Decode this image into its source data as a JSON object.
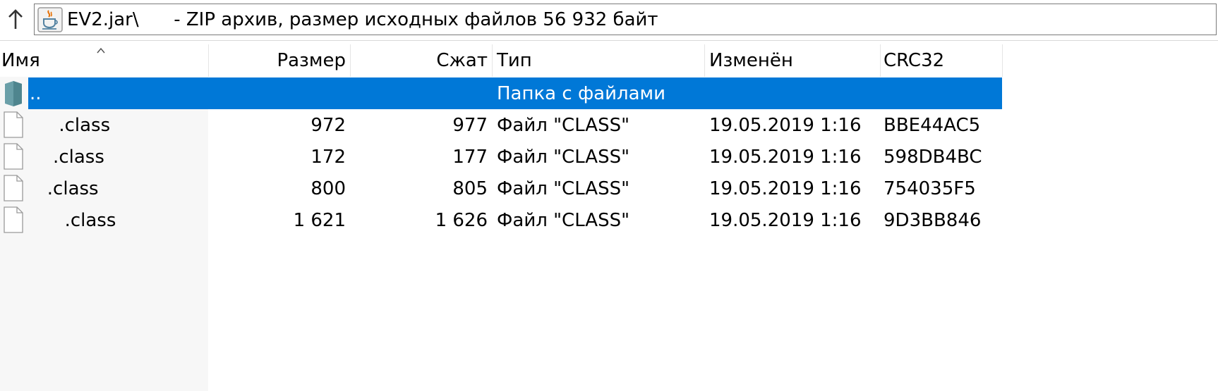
{
  "address": {
    "path": "EV2.jar\\      - ZIP архив, размер исходных файлов 56 932 байт",
    "icon": "java-jar-icon"
  },
  "columns": [
    {
      "key": "name",
      "label": "Имя",
      "sorted": "ascending"
    },
    {
      "key": "size",
      "label": "Размер"
    },
    {
      "key": "packed",
      "label": "Сжат"
    },
    {
      "key": "type",
      "label": "Тип"
    },
    {
      "key": "modified",
      "label": "Изменён"
    },
    {
      "key": "crc",
      "label": "CRC32"
    }
  ],
  "rows": [
    {
      "name": "..",
      "size": "",
      "packed": "",
      "type": "Папка с файлами",
      "modified": "",
      "crc": "",
      "icon": "folder-icon",
      "selected": true
    },
    {
      "name": "     .class",
      "size": "972",
      "packed": "977",
      "type": "Файл \"CLASS\"",
      "modified": "19.05.2019 1:16",
      "crc": "BBE44AC5",
      "icon": "file-icon",
      "selected": false
    },
    {
      "name": "    .class",
      "size": "172",
      "packed": "177",
      "type": "Файл \"CLASS\"",
      "modified": "19.05.2019 1:16",
      "crc": "598DB4BC",
      "icon": "file-icon",
      "selected": false
    },
    {
      "name": "   .class",
      "size": "800",
      "packed": "805",
      "type": "Файл \"CLASS\"",
      "modified": "19.05.2019 1:16",
      "crc": "754035F5",
      "icon": "file-icon",
      "selected": false
    },
    {
      "name": "      .class",
      "size": "1 621",
      "packed": "1 626",
      "type": "Файл \"CLASS\"",
      "modified": "19.05.2019 1:16",
      "crc": "9D3BB846",
      "icon": "file-icon",
      "selected": false
    }
  ],
  "colors": {
    "selection": "#0078d7",
    "name_column_bg": "#f7f7f7"
  }
}
